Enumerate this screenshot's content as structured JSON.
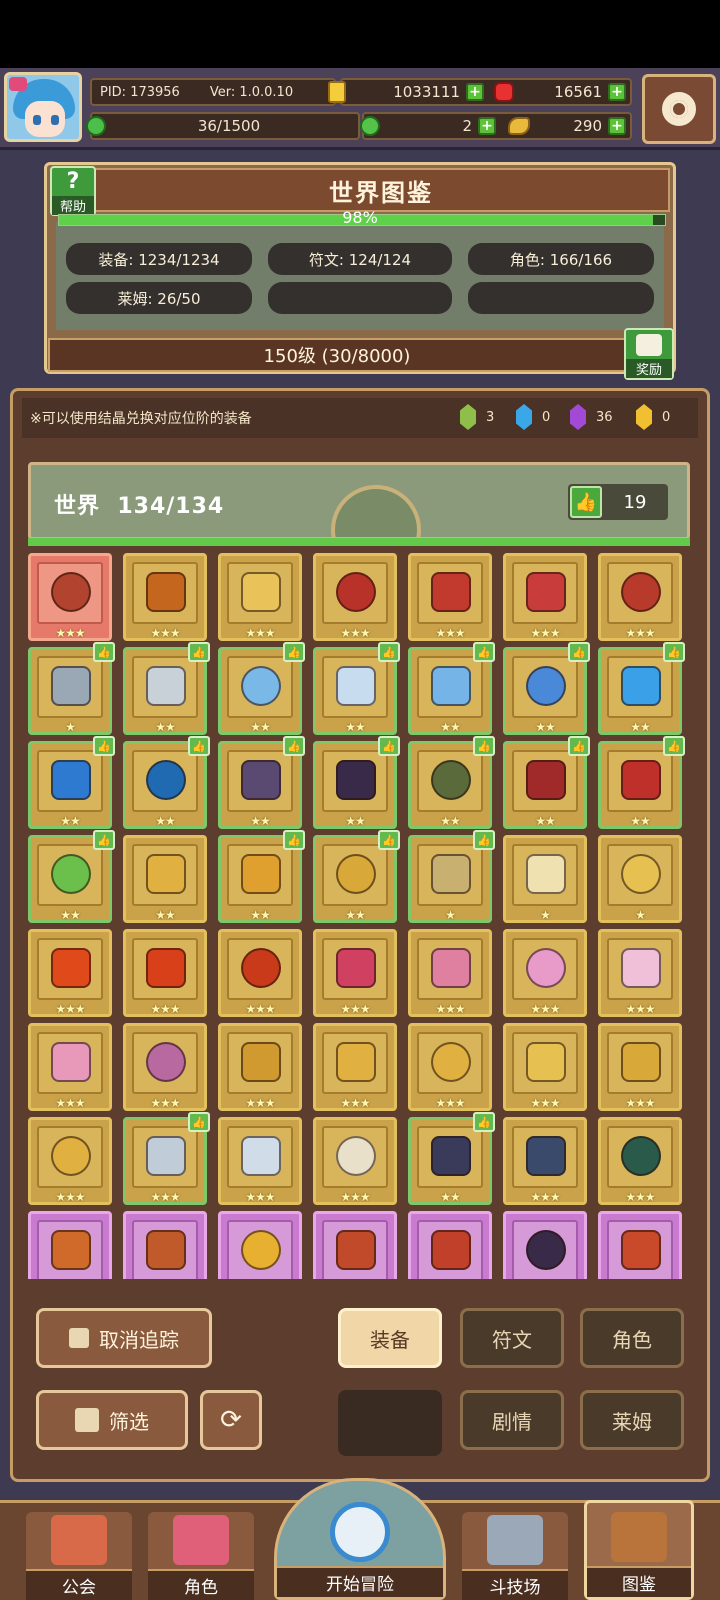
{
  "header": {
    "pid": "PID: 173956",
    "version": "Ver: 1.0.0.10",
    "gold": "1033111",
    "gems": "16561",
    "stamina": "36/1500",
    "clover": "2",
    "wings": "290"
  },
  "collection": {
    "title": "世界图鉴",
    "help_label": "帮助",
    "percent": "98%",
    "percent_value": 0.98,
    "stats": {
      "equipment": "装备: 1234/1234",
      "rune": "符文: 124/124",
      "character": "角色: 166/166",
      "slime": "莱姆: 26/50"
    },
    "level": "150级 (30/8000)",
    "reward_label": "奖励"
  },
  "notice": "※可以使用结晶兑换对应位阶的装备",
  "crystals": [
    {
      "name": "green-crystal",
      "color": "#8fbf4a",
      "count": "3"
    },
    {
      "name": "blue-crystal",
      "color": "#3aa7e8",
      "count": "0"
    },
    {
      "name": "purple-crystal",
      "color": "#a24ad6",
      "count": "36"
    },
    {
      "name": "gold-crystal",
      "color": "#f0c030",
      "count": "0"
    }
  ],
  "world": {
    "title": "世界",
    "count": "134/134",
    "likes": "19"
  },
  "items": [
    {
      "name": "helmet",
      "tone": "red",
      "stars": "★★★",
      "badge": false,
      "color": "#b2432f"
    },
    {
      "name": "staff",
      "tone": "gold",
      "stars": "★★★",
      "badge": false,
      "color": "#c4661e"
    },
    {
      "name": "ring",
      "tone": "gold",
      "stars": "★★★",
      "badge": false,
      "color": "#e9c25a"
    },
    {
      "name": "armor",
      "tone": "gold",
      "stars": "★★★",
      "badge": false,
      "color": "#b8322a"
    },
    {
      "name": "glove",
      "tone": "gold",
      "stars": "★★★",
      "badge": false,
      "color": "#c23a2e"
    },
    {
      "name": "amulet",
      "tone": "gold",
      "stars": "★★★",
      "badge": false,
      "color": "#c83c3c"
    },
    {
      "name": "boots",
      "tone": "gold",
      "stars": "★★★",
      "badge": false,
      "color": "#b83a2a"
    },
    {
      "name": "sword",
      "tone": "green",
      "stars": "★",
      "badge": true,
      "color": "#9aa7b4"
    },
    {
      "name": "shield",
      "tone": "green",
      "stars": "★★",
      "badge": true,
      "color": "#c8d0d8"
    },
    {
      "name": "winged-armor",
      "tone": "green",
      "stars": "★★",
      "badge": true,
      "color": "#7ab8e8"
    },
    {
      "name": "crystal-crown",
      "tone": "green",
      "stars": "★★",
      "badge": true,
      "color": "#c8dcf0"
    },
    {
      "name": "heart-necklace",
      "tone": "green",
      "stars": "★★",
      "badge": true,
      "color": "#74b4e6"
    },
    {
      "name": "orb-ring",
      "tone": "green",
      "stars": "★★",
      "badge": true,
      "color": "#4a88d8"
    },
    {
      "name": "gem-staff",
      "tone": "green",
      "stars": "★★",
      "badge": true,
      "color": "#3aa0e8"
    },
    {
      "name": "blue-orb",
      "tone": "green",
      "stars": "★★",
      "badge": true,
      "color": "#2d7ad0"
    },
    {
      "name": "blue-chalice",
      "tone": "green",
      "stars": "★★",
      "badge": true,
      "color": "#1f6ab0"
    },
    {
      "name": "dark-gem",
      "tone": "green",
      "stars": "★★",
      "badge": true,
      "color": "#5a4a72"
    },
    {
      "name": "pendant",
      "tone": "green",
      "stars": "★★",
      "badge": true,
      "color": "#3a2a4a"
    },
    {
      "name": "green-ring",
      "tone": "green",
      "stars": "★★",
      "badge": true,
      "color": "#5a6a3a"
    },
    {
      "name": "red-armor",
      "tone": "green",
      "stars": "★★",
      "badge": true,
      "color": "#a02a2a"
    },
    {
      "name": "red-circlet",
      "tone": "green",
      "stars": "★★",
      "badge": true,
      "color": "#c0302a"
    },
    {
      "name": "emerald-ring",
      "tone": "green",
      "stars": "★★",
      "badge": true,
      "color": "#6ac04a"
    },
    {
      "name": "gold-crown",
      "tone": "gold",
      "stars": "★★",
      "badge": false,
      "color": "#e0b040"
    },
    {
      "name": "jewel-brooch",
      "tone": "green",
      "stars": "★★",
      "badge": true,
      "color": "#e0a030"
    },
    {
      "name": "ruby-necklace",
      "tone": "green",
      "stars": "★★",
      "badge": true,
      "color": "#d8a838"
    },
    {
      "name": "bow",
      "tone": "green",
      "stars": "★",
      "badge": true,
      "color": "#c8b070"
    },
    {
      "name": "bone-wand",
      "tone": "gold",
      "stars": "★",
      "badge": false,
      "color": "#efe2b0"
    },
    {
      "name": "gold-band",
      "tone": "gold",
      "stars": "★",
      "badge": false,
      "color": "#e6c050"
    },
    {
      "name": "fire-gem",
      "tone": "gold",
      "stars": "★★★",
      "badge": false,
      "color": "#e04a1a"
    },
    {
      "name": "fire-heart",
      "tone": "gold",
      "stars": "★★★",
      "badge": false,
      "color": "#d8401a"
    },
    {
      "name": "fire-ring",
      "tone": "gold",
      "stars": "★★★",
      "badge": false,
      "color": "#c83a1a"
    },
    {
      "name": "bear-doll",
      "tone": "gold",
      "stars": "★★★",
      "badge": false,
      "color": "#d04060"
    },
    {
      "name": "bear-mask",
      "tone": "gold",
      "stars": "★★★",
      "badge": false,
      "color": "#e080a0"
    },
    {
      "name": "pink-dress",
      "tone": "gold",
      "stars": "★★★",
      "badge": false,
      "color": "#e89ac8"
    },
    {
      "name": "angel-wings",
      "tone": "gold",
      "stars": "★★★",
      "badge": false,
      "color": "#f0c0d8"
    },
    {
      "name": "heart-ring",
      "tone": "gold",
      "stars": "★★★",
      "badge": false,
      "color": "#e898b8"
    },
    {
      "name": "winged-heart",
      "tone": "gold",
      "stars": "★★★",
      "badge": false,
      "color": "#b86aa0"
    },
    {
      "name": "gold-scepter",
      "tone": "gold",
      "stars": "★★★",
      "badge": false,
      "color": "#d09a30"
    },
    {
      "name": "gold-ring",
      "tone": "gold",
      "stars": "★★★",
      "badge": false,
      "color": "#e0b040"
    },
    {
      "name": "gold-boots",
      "tone": "gold",
      "stars": "★★★",
      "badge": false,
      "color": "#e0b040"
    },
    {
      "name": "gold-plate",
      "tone": "gold",
      "stars": "★★★",
      "badge": false,
      "color": "#e6c050"
    },
    {
      "name": "gold-collar",
      "tone": "gold",
      "stars": "★★★",
      "badge": false,
      "color": "#d8a838"
    },
    {
      "name": "gold-armor",
      "tone": "gold",
      "stars": "★★★",
      "badge": false,
      "color": "#e0b040"
    },
    {
      "name": "crossed-swords",
      "tone": "green",
      "stars": "★★★",
      "badge": true,
      "color": "#c0ccd8"
    },
    {
      "name": "twin-daggers",
      "tone": "gold",
      "stars": "★★★",
      "badge": false,
      "color": "#d0dce8"
    },
    {
      "name": "cross-shield",
      "tone": "gold",
      "stars": "★★★",
      "badge": false,
      "color": "#e8e0c8"
    },
    {
      "name": "rose-gauntlet",
      "tone": "green",
      "stars": "★★",
      "badge": true,
      "color": "#3a3a5a"
    },
    {
      "name": "dark-crown",
      "tone": "gold",
      "stars": "★★★",
      "badge": false,
      "color": "#3a4a6a"
    },
    {
      "name": "dark-boots",
      "tone": "gold",
      "stars": "★★★",
      "badge": false,
      "color": "#2a5a4a"
    },
    {
      "name": "flame-sword",
      "tone": "purple",
      "stars": "",
      "badge": false,
      "color": "#d06a2a"
    },
    {
      "name": "flame-axe",
      "tone": "purple",
      "stars": "",
      "badge": false,
      "color": "#c05a2a"
    },
    {
      "name": "sun-crown",
      "tone": "purple",
      "stars": "",
      "badge": false,
      "color": "#e8b030"
    },
    {
      "name": "horned-helm",
      "tone": "purple",
      "stars": "",
      "badge": false,
      "color": "#c04a2a"
    },
    {
      "name": "flame-armor",
      "tone": "purple",
      "stars": "",
      "badge": false,
      "color": "#c0402a"
    },
    {
      "name": "dark-heart",
      "tone": "purple",
      "stars": "",
      "badge": false,
      "color": "#3a2a4a"
    },
    {
      "name": "flame-boots",
      "tone": "purple",
      "stars": "",
      "badge": false,
      "color": "#c84a2a"
    }
  ],
  "controls": {
    "untrack": "取消追踪",
    "filter": "筛选",
    "equipment": "装备",
    "rune": "符文",
    "character": "角色",
    "story": "剧情",
    "slime": "莱姆"
  },
  "nav": {
    "guild": "公会",
    "character": "角色",
    "adventure": "开始冒险",
    "arena": "斗技场",
    "codex": "图鉴"
  }
}
